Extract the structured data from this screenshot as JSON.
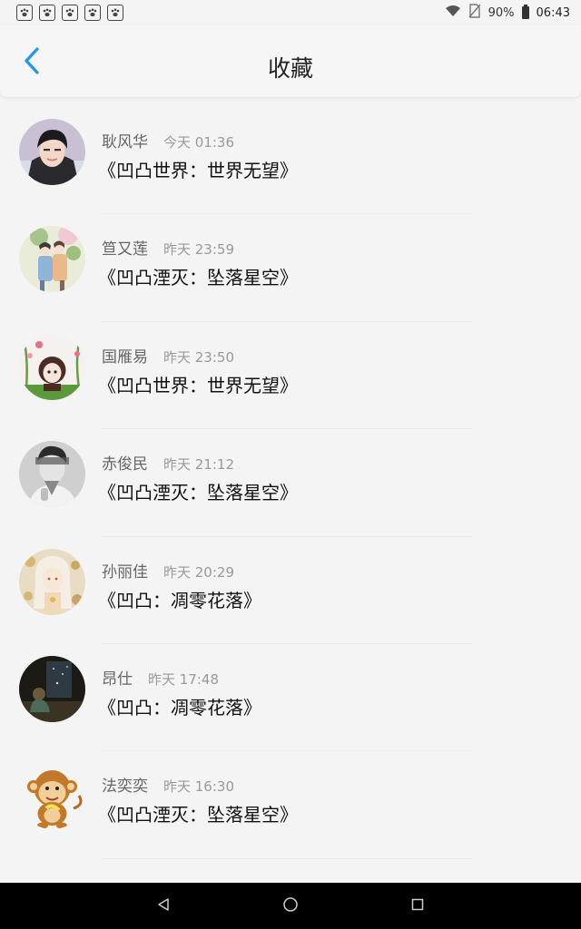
{
  "status_bar": {
    "battery": "90%",
    "time": "06:43",
    "notification_icons": [
      "paw-icon",
      "paw-icon",
      "paw-icon",
      "paw-icon",
      "paw-icon"
    ]
  },
  "header": {
    "title": "收藏",
    "back_icon": "chevron-left-icon",
    "accent_color": "#2196f3"
  },
  "favorites": [
    {
      "user": "耿风华",
      "time": "今天 01:36",
      "title": "《凹凸世界：世界无望》",
      "avatar": "boy-portrait"
    },
    {
      "user": "笪又莲",
      "time": "昨天 23:59",
      "title": "《凹凸湮灭：坠落星空》",
      "avatar": "couple-illustration"
    },
    {
      "user": "国雁易",
      "time": "昨天 23:50",
      "title": "《凹凸世界：世界无望》",
      "avatar": "cartoon-girl"
    },
    {
      "user": "赤俊民",
      "time": "昨天 21:12",
      "title": "《凹凸湮灭：坠落星空》",
      "avatar": "grayscale-portrait"
    },
    {
      "user": "孙丽佳",
      "time": "昨天 20:29",
      "title": "《凹凸：凋零花落》",
      "avatar": "anime-girl"
    },
    {
      "user": "昂仕",
      "time": "昨天 17:48",
      "title": "《凹凸：凋零花落》",
      "avatar": "night-window"
    },
    {
      "user": "法奕奕",
      "time": "昨天 16:30",
      "title": "《凹凸湮灭：坠落星空》",
      "avatar": "monkey-cartoon"
    }
  ],
  "nav_bar": {
    "back_icon": "triangle-back-icon",
    "home_icon": "circle-home-icon",
    "recents_icon": "square-recents-icon"
  }
}
